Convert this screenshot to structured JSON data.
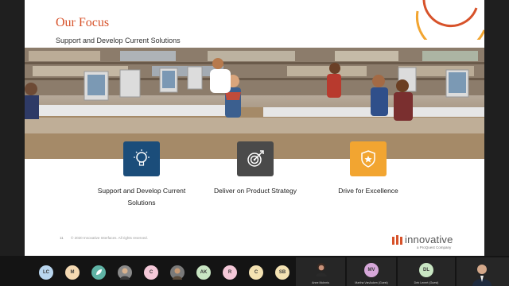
{
  "slide": {
    "title": "Our Focus",
    "subtitle": "Support and Develop Current Solutions",
    "focus_items": [
      {
        "label": "Support and Develop Current Solutions",
        "icon": "lightbulb-icon",
        "color": "#1b4d7a"
      },
      {
        "label": "Deliver on Product Strategy",
        "icon": "target-icon",
        "color": "#4a4a4a"
      },
      {
        "label": "Drive for Excellence",
        "icon": "shield-star-icon",
        "color": "#f2a531"
      }
    ],
    "page_number": "11",
    "copyright": "© 2020 Innovative Interfaces. All rights reserved.",
    "brand": {
      "name": "innovative",
      "tagline": "a ProQuest Company"
    },
    "colors": {
      "accent": "#d7522a",
      "arc_red": "#d7522a",
      "arc_orange": "#f2a531"
    }
  },
  "participants": {
    "avatars": [
      {
        "initials": "LC",
        "color": "#b9d6ef"
      },
      {
        "initials": "M",
        "color": "#f4d9b2"
      },
      {
        "initials": "",
        "color": "#5fb3a5"
      },
      {
        "initials": "",
        "color": "#8a8a8a"
      },
      {
        "initials": "C",
        "color": "#f4c8d8"
      },
      {
        "initials": "",
        "color": "#7a7a7a"
      },
      {
        "initials": "AK",
        "color": "#c9e6c3"
      },
      {
        "initials": "R",
        "color": "#f4c8d8"
      },
      {
        "initials": "C",
        "color": "#f4e2b2"
      },
      {
        "initials": "SB",
        "color": "#f4e2b2"
      }
    ],
    "videos": [
      {
        "name": "Anne McInnis"
      },
      {
        "name": "Martha VanAuken (Guest)",
        "initials": "MV",
        "color": "#d6a7d9"
      },
      {
        "name": "Deb Lenert (Guest)",
        "initials": "DL",
        "color": "#c9e6c3"
      },
      {
        "name": ""
      }
    ]
  }
}
